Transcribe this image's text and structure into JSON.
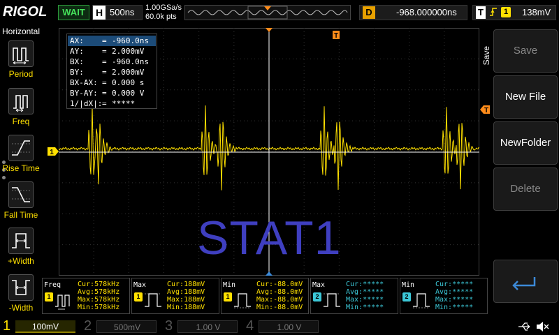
{
  "header": {
    "brand": "RIGOL",
    "run_status": "WAIT",
    "horizontal_label": "H",
    "timebase": "500ns",
    "sample_rate": "1.00GSa/s",
    "memory_depth": "60.0k pts",
    "delay_label": "D",
    "delay": "-968.000000ns",
    "trigger_label": "T",
    "trigger_source": "1",
    "trigger_level": "138mV"
  },
  "left_menu": {
    "title": "Horizontal",
    "items": [
      {
        "label": "Period",
        "icon": "period-icon"
      },
      {
        "label": "Freq",
        "icon": "freq-icon"
      },
      {
        "label": "Rise Time",
        "icon": "rise-time-icon"
      },
      {
        "label": "Fall Time",
        "icon": "fall-time-icon"
      },
      {
        "label": "+Width",
        "icon": "pos-width-icon"
      },
      {
        "label": "-Width",
        "icon": "neg-width-icon"
      }
    ]
  },
  "cursor_table": {
    "rows": [
      {
        "key": "AX:",
        "value": "-960.0ns"
      },
      {
        "key": "AY:",
        "value": "2.000mV"
      },
      {
        "key": "BX:",
        "value": "-960.0ns"
      },
      {
        "key": "BY:",
        "value": "2.000mV"
      },
      {
        "key": "BX-AX:",
        "value": "0.000 s"
      },
      {
        "key": "BY-AY:",
        "value": "0.000 V"
      },
      {
        "key": "1/|dX|:",
        "value": "*****"
      }
    ],
    "equals": "="
  },
  "markers": {
    "trigger_pos": "T",
    "trigger_level": "T",
    "channel1": "1"
  },
  "watermark": "STAT1",
  "right_menu": {
    "title": "Save",
    "buttons": [
      {
        "label": "Save",
        "enabled": false
      },
      {
        "label": "New File",
        "enabled": true
      },
      {
        "label": "NewFolder",
        "enabled": true
      },
      {
        "label": "Delete",
        "enabled": false
      }
    ],
    "back_icon": "return-arrow-icon"
  },
  "measurements": [
    {
      "title": "Freq",
      "channel": "1",
      "cur": "578kHz",
      "avg": "578kHz",
      "max": "578kHz",
      "min": "578kHz"
    },
    {
      "title": "Max",
      "channel": "1",
      "cur": "188mV",
      "avg": "188mV",
      "max": "188mV",
      "min": "188mV"
    },
    {
      "title": "Min",
      "channel": "1",
      "cur": "-88.0mV",
      "avg": "-88.0mV",
      "max": "-88.0mV",
      "min": "-88.0mV"
    },
    {
      "title": "Max",
      "channel": "2",
      "cur": "*****",
      "avg": "*****",
      "max": "*****",
      "min": "*****"
    },
    {
      "title": "Min",
      "channel": "2",
      "cur": "*****",
      "avg": "*****",
      "max": "*****",
      "min": "*****"
    }
  ],
  "meas_labels": {
    "cur": "Cur:",
    "avg": "Avg:",
    "max": "Max:",
    "min": "Min:"
  },
  "channels": [
    {
      "num": "1",
      "scale": "100mV",
      "active": true
    },
    {
      "num": "2",
      "scale": "500mV",
      "active": false
    },
    {
      "num": "3",
      "scale": "1.00 V",
      "active": false
    },
    {
      "num": "4",
      "scale": "1.00 V",
      "active": false
    }
  ],
  "colors": {
    "ch1": "#ffe000",
    "ch2": "#3cc8d8",
    "trigger": "#ff8c1a",
    "watermark": "#3f3fc0",
    "status_green": "#45e25a"
  }
}
